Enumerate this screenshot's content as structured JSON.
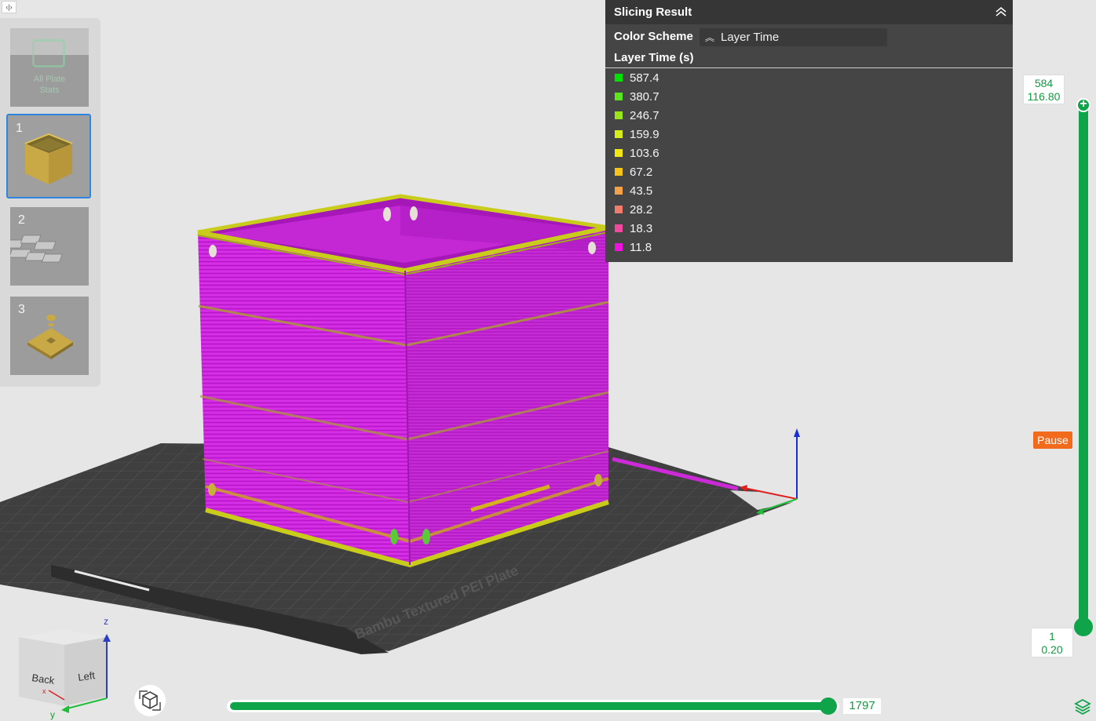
{
  "plates": {
    "all_plates_label_line1": "All Plate",
    "all_plates_label_line2": "Stats",
    "items": [
      {
        "number": "1"
      },
      {
        "number": "2"
      },
      {
        "number": "3"
      }
    ]
  },
  "slicing_result": {
    "title": "Slicing Result",
    "color_scheme_label": "Color Scheme",
    "color_scheme_value": "Layer Time",
    "legend_title": "Layer Time (s)",
    "legend": [
      {
        "value": "587.4",
        "color": "#00e000"
      },
      {
        "value": "380.7",
        "color": "#5ce41c"
      },
      {
        "value": "246.7",
        "color": "#9ae41a"
      },
      {
        "value": "159.9",
        "color": "#d8ec16"
      },
      {
        "value": "103.6",
        "color": "#f2e612"
      },
      {
        "value": "67.2",
        "color": "#f5c41c"
      },
      {
        "value": "43.5",
        "color": "#f3a24a"
      },
      {
        "value": "28.2",
        "color": "#ef7c6c"
      },
      {
        "value": "18.3",
        "color": "#ef4aa0"
      },
      {
        "value": "11.8",
        "color": "#ee14e0"
      }
    ]
  },
  "layer_slider": {
    "top_layer": "584",
    "top_height": "116.80",
    "bottom_layer": "1",
    "bottom_height": "0.20",
    "pause_label": "Pause"
  },
  "move_slider": {
    "value": "1797"
  },
  "view_cube": {
    "back_label": "Back",
    "left_label": "Left",
    "z_label": "z",
    "y_label": "y",
    "x_label": "x"
  },
  "bed_label": "Bambu Textured PEI Plate",
  "colors": {
    "accent_green": "#0fa34a",
    "pause_orange": "#f26b1d",
    "print_magenta": "#d21fe0",
    "print_yellow": "#c7c91e",
    "selection_blue": "#2f86e0"
  }
}
